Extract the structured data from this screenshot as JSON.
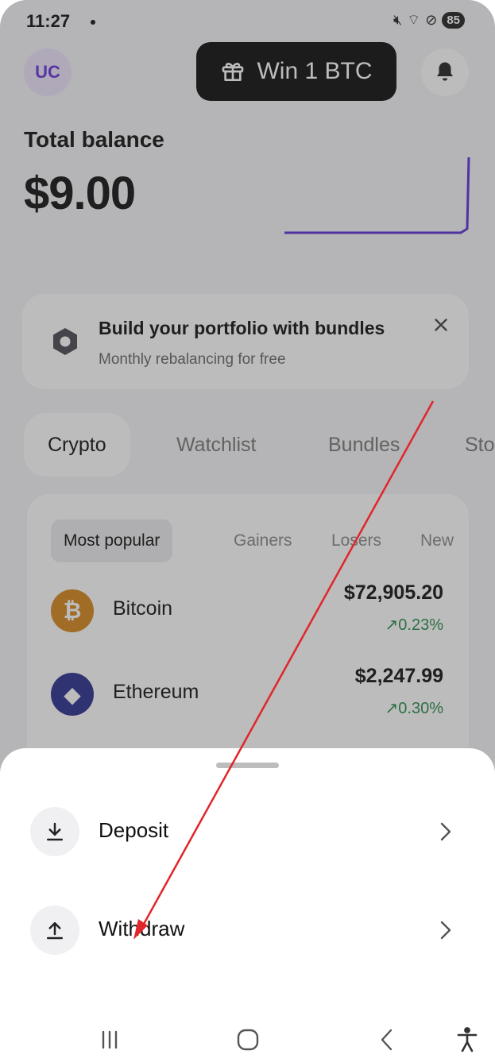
{
  "status_bar": {
    "time": "11:27",
    "battery": "85"
  },
  "header": {
    "avatar_initials": "UC",
    "promo_label": "Win 1 BTC"
  },
  "balance": {
    "label": "Total balance",
    "value": "$9.00"
  },
  "bundle_banner": {
    "title": "Build your portfolio with bundles",
    "subtitle": "Monthly rebalancing for free"
  },
  "tabs": [
    {
      "label": "Crypto",
      "active": true
    },
    {
      "label": "Watchlist",
      "active": false
    },
    {
      "label": "Bundles",
      "active": false
    },
    {
      "label": "Sto",
      "active": false
    }
  ],
  "market": {
    "subtabs": [
      {
        "label": "Most popular",
        "active": true
      },
      {
        "label": "Gainers",
        "active": false
      },
      {
        "label": "Losers",
        "active": false
      },
      {
        "label": "New",
        "active": false
      }
    ],
    "assets": [
      {
        "name": "Bitcoin",
        "price": "$72,905.20",
        "change": "0.23%",
        "logo_symbol": "₿",
        "logo_color": "#d6861c"
      },
      {
        "name": "Ethereum",
        "price": "$2,247.99",
        "change": "0.30%",
        "logo_symbol": "◆",
        "logo_color": "#2b2f8e"
      }
    ]
  },
  "sheet": {
    "items": [
      {
        "label": "Deposit",
        "icon": "download-icon"
      },
      {
        "label": "Withdraw",
        "icon": "upload-icon"
      }
    ]
  },
  "colors": {
    "accent": "#6a34d9",
    "positive": "#2a8a4a",
    "annotation": "#e0262b"
  }
}
